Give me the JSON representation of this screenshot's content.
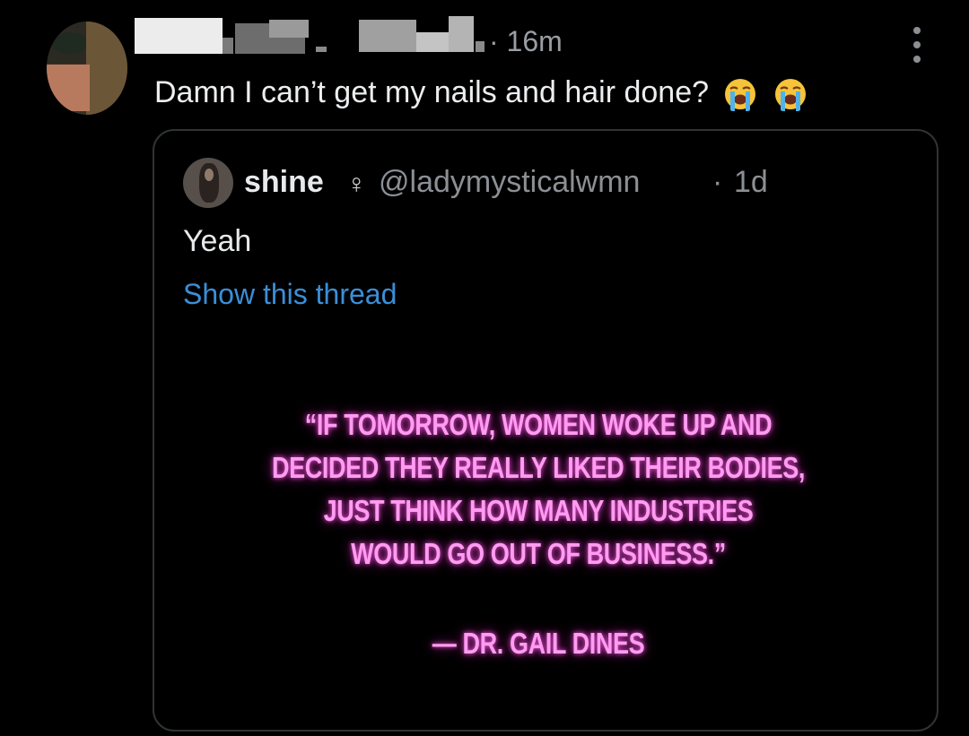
{
  "post": {
    "time": "· 16m",
    "text": "Damn I can’t get my nails and hair done?",
    "reaction_emoji": [
      "loudly-crying-face",
      "loudly-crying-face"
    ]
  },
  "quoted": {
    "name": "shine",
    "gender_symbol": "♀",
    "handle": "@ladymysticalwmn",
    "separator": "·",
    "time": "1d",
    "text": "Yeah",
    "thread_link": "Show this thread",
    "image": {
      "lines": [
        "“IF TOMORROW, WOMEN WOKE UP AND",
        "DECIDED THEY REALLY LIKED THEIR BODIES,",
        "JUST THINK HOW MANY INDUSTRIES",
        "WOULD GO OUT OF BUSINESS.”"
      ],
      "attribution": "— DR. GAIL DINES"
    }
  },
  "colors": {
    "background": "#000000",
    "text": "#e7e9ea",
    "muted": "#8b9095",
    "link": "#3a8fd8",
    "neon": "#ff9cf0"
  }
}
